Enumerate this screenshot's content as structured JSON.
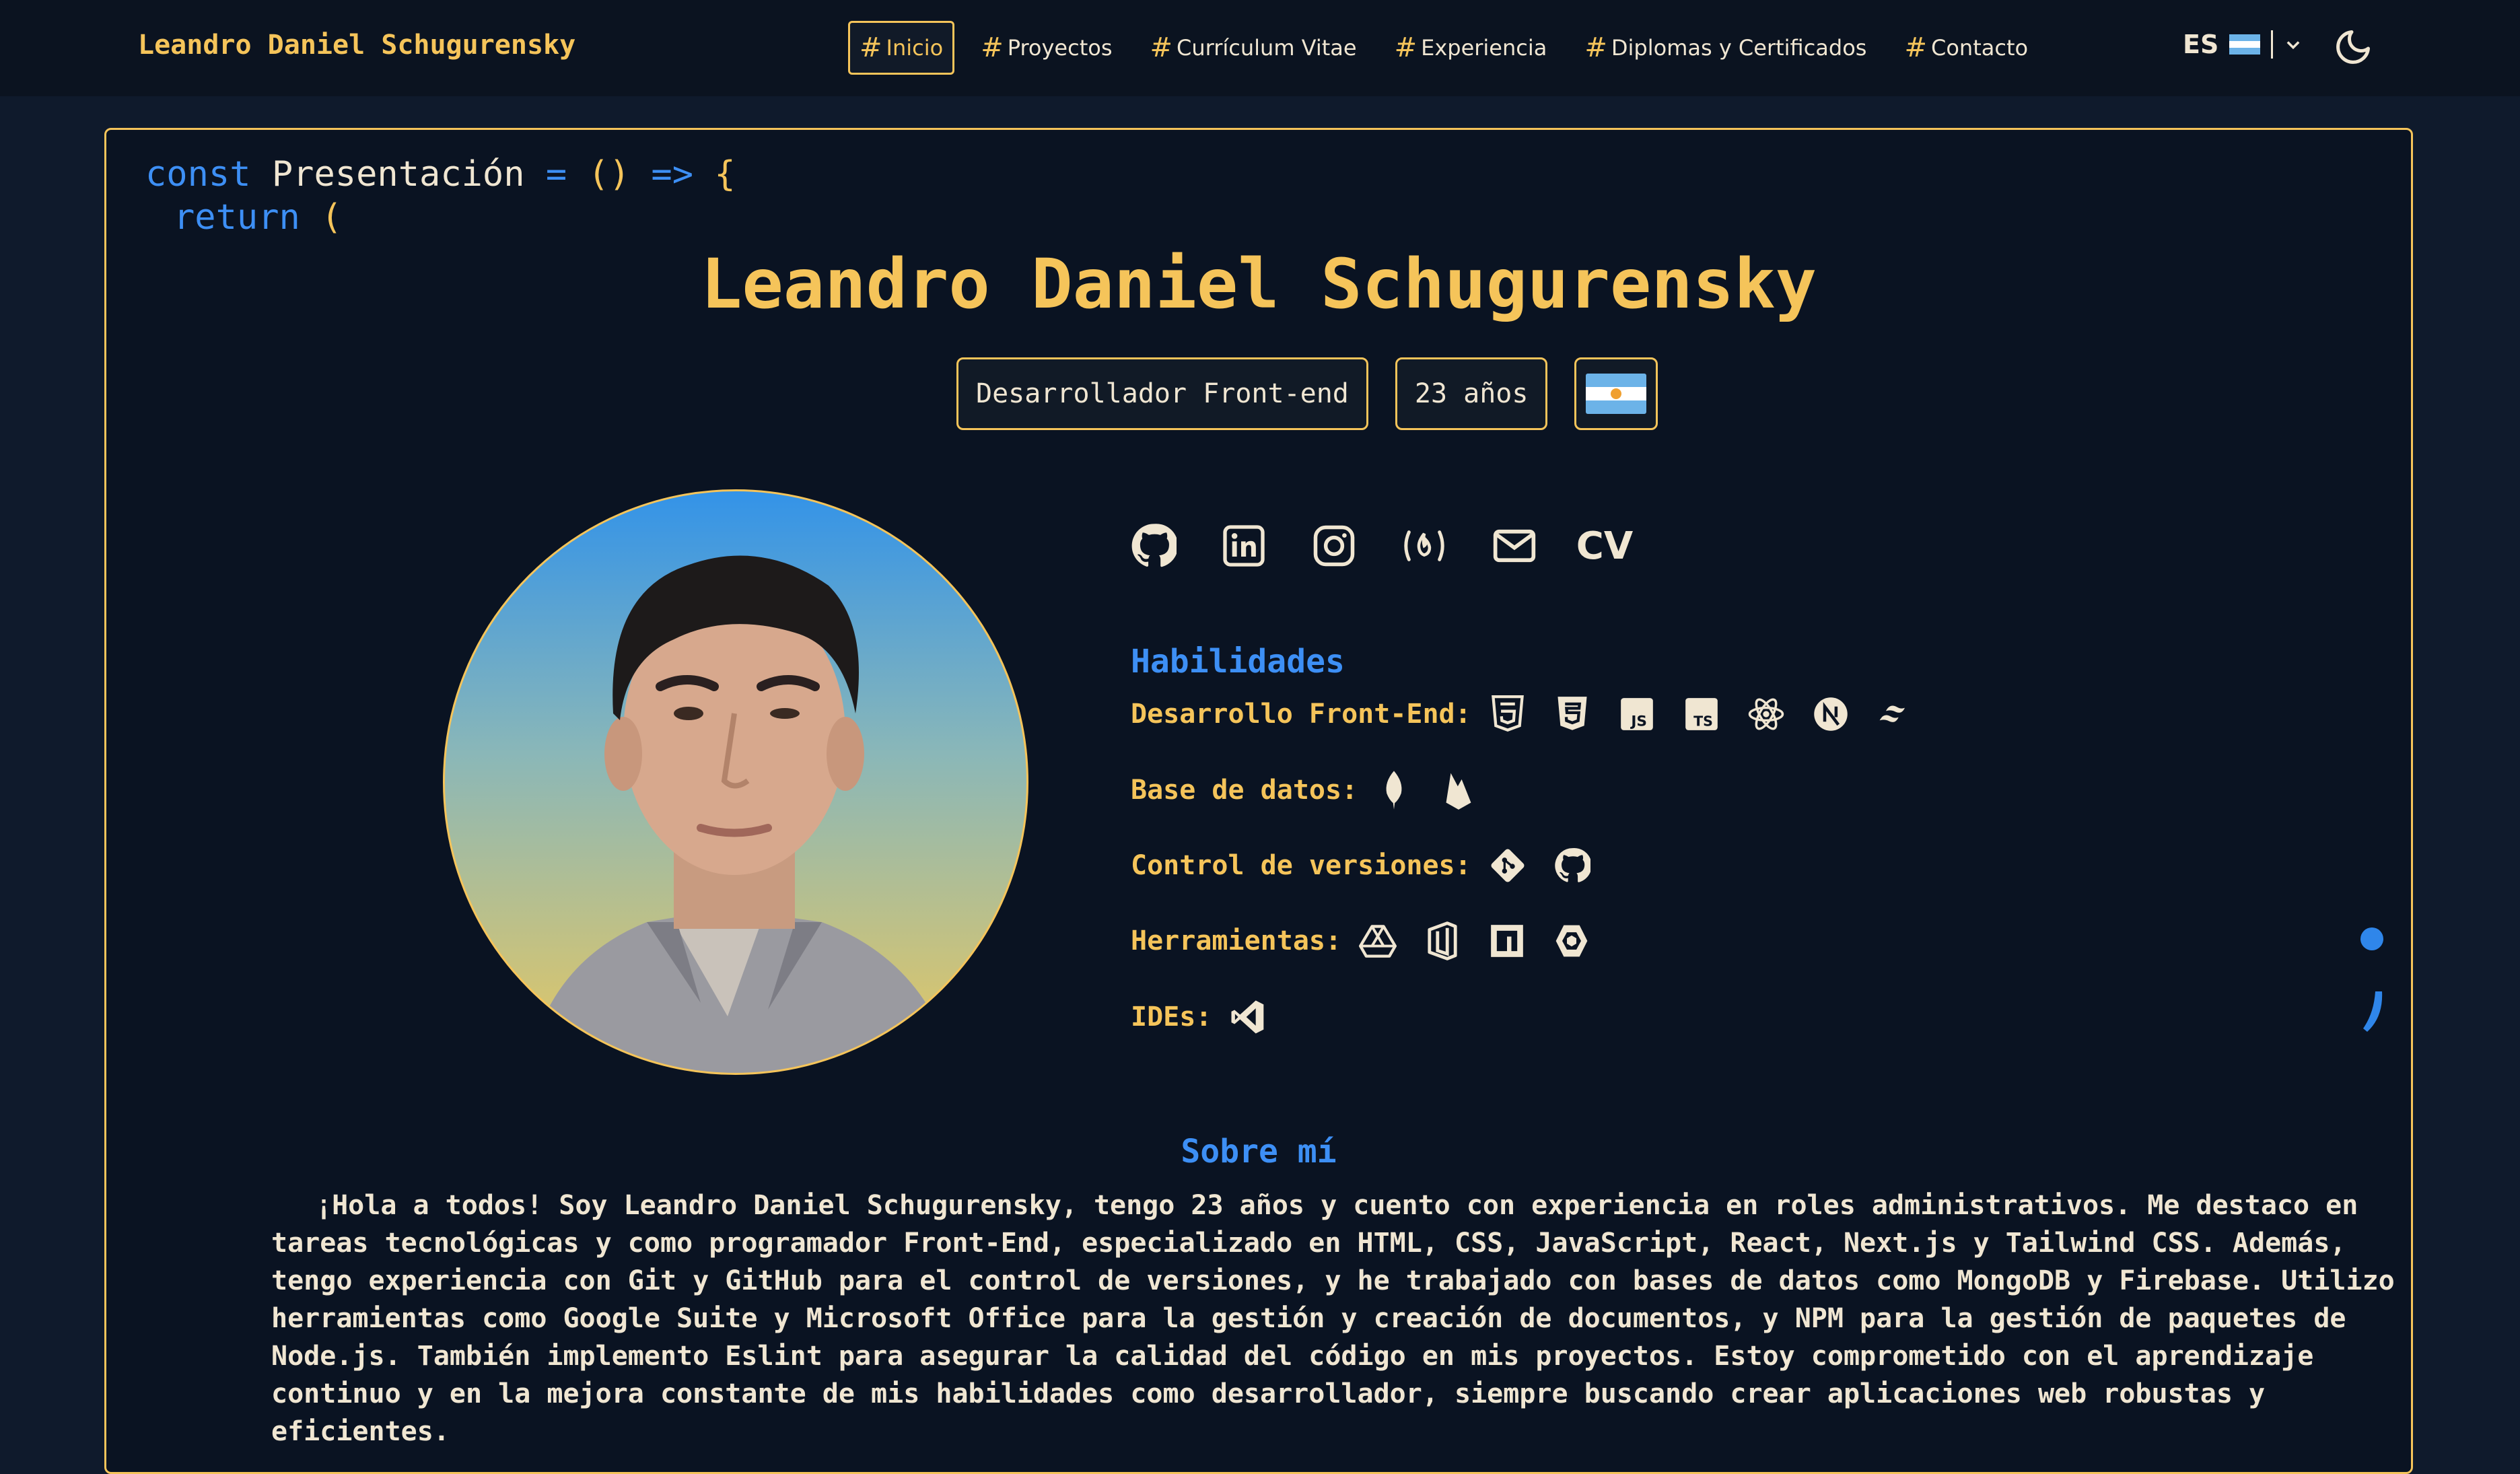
{
  "nav": {
    "brand": "Leandro Daniel Schugurensky",
    "links": [
      {
        "hash": "#",
        "label": "Inicio"
      },
      {
        "hash": "#",
        "label": "Proyectos"
      },
      {
        "hash": "#",
        "label": "Currículum Vitae"
      },
      {
        "hash": "#",
        "label": "Experiencia"
      },
      {
        "hash": "#",
        "label": "Diplomas y Certificados"
      },
      {
        "hash": "#",
        "label": "Contacto"
      }
    ],
    "language": "ES",
    "active_link": "Inicio"
  },
  "code": {
    "const": "const",
    "name": "Presentación",
    "eq": "=",
    "parens": "()",
    "arrow": "=>",
    "brace": "{",
    "return": "return",
    "paren_open": "("
  },
  "hero": {
    "name": "Leandro Daniel Schugurensky",
    "role": "Desarrollador Front-end",
    "age": "23 años"
  },
  "socials": {
    "icons": [
      "github-icon",
      "linkedin-icon",
      "instagram-icon",
      "freecodecamp-icon",
      "mail-icon"
    ],
    "cv_label": "CV"
  },
  "skills": {
    "title": "Habilidades",
    "groups": [
      {
        "label": "Desarrollo Front-End:",
        "icons": [
          "html5-icon",
          "css3-icon",
          "javascript-icon",
          "typescript-icon",
          "react-icon",
          "nextjs-icon",
          "tailwind-icon"
        ]
      },
      {
        "label": "Base de datos:",
        "icons": [
          "mongodb-icon",
          "firebase-icon"
        ]
      },
      {
        "label": "Control de versiones:",
        "icons": [
          "git-icon",
          "github-icon"
        ]
      },
      {
        "label": "Herramientas:",
        "icons": [
          "google-drive-icon",
          "office-icon",
          "npm-icon",
          "eslint-icon"
        ]
      },
      {
        "label": "IDEs:",
        "icons": [
          "vscode-icon"
        ]
      }
    ]
  },
  "about": {
    "title": "Sobre mí",
    "text": "¡Hola a todos! Soy Leandro Daniel Schugurensky, tengo 23 años y cuento con experiencia en roles administrativos. Me destaco en tareas tecnológicas y como programador Front-End, especializado en HTML, CSS, JavaScript, React, Next.js y Tailwind CSS. Además, tengo experiencia con Git y GitHub para el control de versiones, y he trabajado con bases de datos como MongoDB y Firebase. Utilizo herramientas como Google Suite y Microsoft Office para la gestión y creación de documentos, y NPM para la gestión de paquetes de Node.js. También implemento Eslint para asegurar la calidad del código en mis proyectos. Estoy comprometido con el aprendizaje continuo y en la mejora constante de mis habilidades como desarrollador, siempre buscando crear aplicaciones web robustas y eficientes."
  },
  "colors": {
    "accent": "#f5c45a",
    "keyword": "#3d8ff5",
    "background": "#0f1a2c",
    "navbar": "#0b1320"
  }
}
